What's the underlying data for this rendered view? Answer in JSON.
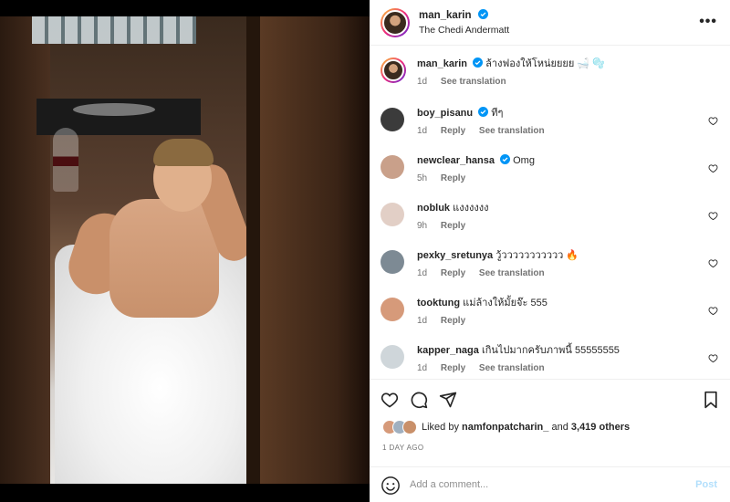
{
  "post": {
    "username": "man_karin",
    "location": "The Chedi Andermatt",
    "more_label": "•••"
  },
  "caption": {
    "username": "man_karin",
    "text": "ล้างฟองให้โหน่ยยยย 🛁 🫧",
    "time": "1d",
    "translate": "See translation"
  },
  "comments": [
    {
      "username": "boy_pisanu",
      "verified": true,
      "text": "ทีๆ",
      "time": "1d",
      "reply": "Reply",
      "translate": "See translation",
      "avatar_color": "#3b3b3b"
    },
    {
      "username": "newclear_hansa",
      "verified": true,
      "text": "Omg",
      "time": "5h",
      "reply": "Reply",
      "translate": "",
      "avatar_color": "#c9a08a"
    },
    {
      "username": "nobluk",
      "verified": false,
      "text": "แงงงงงง",
      "time": "9h",
      "reply": "Reply",
      "translate": "",
      "avatar_color": "#e2cfc6"
    },
    {
      "username": "pexky_sretunya",
      "verified": false,
      "text": "วู้ววววววววววว 🔥",
      "time": "1d",
      "reply": "Reply",
      "translate": "See translation",
      "avatar_color": "#7d8a94"
    },
    {
      "username": "tooktung",
      "verified": false,
      "text": "แม่ล้างให้มั้ยจ๊ะ 555",
      "time": "1d",
      "reply": "Reply",
      "translate": "",
      "avatar_color": "#d69a7a"
    },
    {
      "username": "kapper_naga",
      "verified": false,
      "text": "เกินไปมากครับภาพนี้ 55555555",
      "time": "1d",
      "reply": "Reply",
      "translate": "See translation",
      "avatar_color": "#cfd6da"
    }
  ],
  "likes": {
    "prefix": "Liked by",
    "user": "namfonpatcharin_",
    "middle": "and",
    "count": "3,419 others"
  },
  "date": "1 DAY AGO",
  "add_comment": {
    "placeholder": "Add a comment...",
    "post_label": "Post"
  },
  "colors": {
    "verified": "#0095f6",
    "post_disabled": "#b2dffc",
    "meta": "#737373"
  }
}
